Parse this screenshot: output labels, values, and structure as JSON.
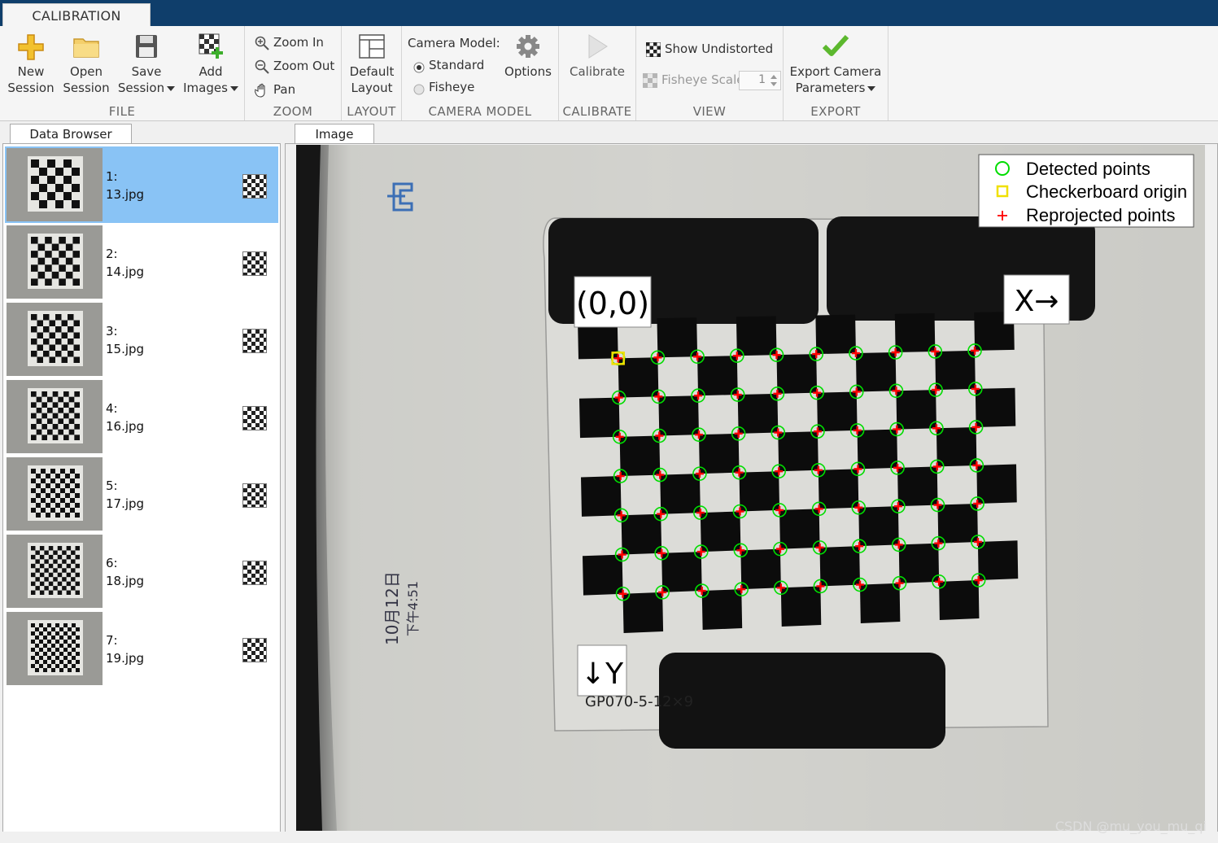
{
  "ribbon": {
    "tab": "CALIBRATION",
    "file": {
      "title": "FILE",
      "new_session": [
        "New",
        "Session"
      ],
      "open_session": [
        "Open",
        "Session"
      ],
      "save_session": [
        "Save",
        "Session"
      ],
      "add_images": [
        "Add",
        "Images"
      ]
    },
    "zoom": {
      "title": "ZOOM",
      "zoom_in": "Zoom In",
      "zoom_out": "Zoom Out",
      "pan": "Pan"
    },
    "layout": {
      "title": "LAYOUT",
      "default_layout": [
        "Default",
        "Layout"
      ]
    },
    "camera_model": {
      "title": "CAMERA MODEL",
      "label": "Camera Model:",
      "standard": "Standard",
      "fisheye": "Fisheye",
      "options": "Options",
      "selected": "Standard"
    },
    "calibrate": {
      "title": "CALIBRATE",
      "calibrate": "Calibrate"
    },
    "view": {
      "title": "VIEW",
      "show_undistorted": "Show Undistorted",
      "fisheye_scale_label": "Fisheye Scale",
      "fisheye_scale_value": "1"
    },
    "export": {
      "title": "EXPORT",
      "export_params": [
        "Export Camera",
        "Parameters"
      ]
    }
  },
  "data_browser": {
    "tab": "Data Browser",
    "items": [
      {
        "index": "1:",
        "file": "13.jpg",
        "selected": true
      },
      {
        "index": "2:",
        "file": "14.jpg",
        "selected": false
      },
      {
        "index": "3:",
        "file": "15.jpg",
        "selected": false
      },
      {
        "index": "4:",
        "file": "16.jpg",
        "selected": false
      },
      {
        "index": "5:",
        "file": "17.jpg",
        "selected": false
      },
      {
        "index": "6:",
        "file": "18.jpg",
        "selected": false
      },
      {
        "index": "7:",
        "file": "19.jpg",
        "selected": false
      }
    ]
  },
  "image_panel": {
    "tab": "Image",
    "legend": {
      "detected": "Detected points",
      "origin": "Checkerboard origin",
      "reprojected": "Reprojected points"
    },
    "origin_label": "(0,0)",
    "x_label": "X→",
    "y_label": "↓Y",
    "photo_text": {
      "date": "10月12日",
      "time": "下午4:51",
      "board_code": "GP070-5-12×9"
    },
    "colors": {
      "detected": "#00dd00",
      "origin": "#f0e000",
      "reprojected": "#ff0000"
    }
  },
  "watermark": "CSDN @mu_you_mu_qi"
}
